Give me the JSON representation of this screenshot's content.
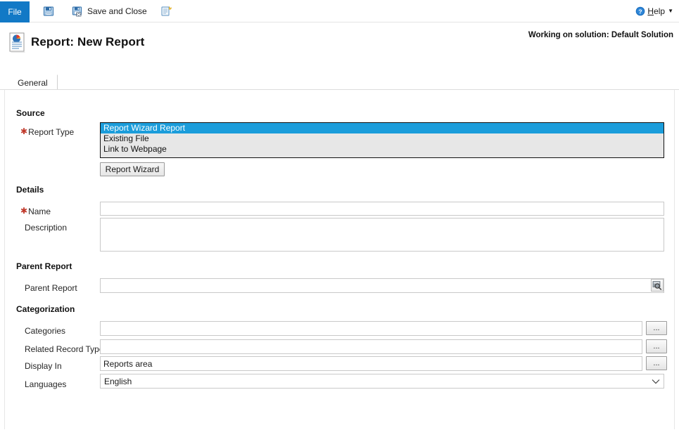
{
  "commandbar": {
    "file_tab": "File",
    "buttons": [
      {
        "name": "save-button",
        "icon": "save-icon",
        "label": ""
      },
      {
        "name": "save-and-close-button",
        "icon": "save-and-close-icon",
        "label": "Save and Close"
      },
      {
        "name": "new-button",
        "icon": "new-record-icon",
        "label": ""
      }
    ],
    "help": {
      "icon": "help-icon",
      "label_prefix": "",
      "label_accesskey": "H",
      "label_rest": "elp",
      "caret": "▼"
    }
  },
  "header": {
    "icon": "report-icon",
    "title": "Report: New Report",
    "solution_note": "Working on solution: Default Solution"
  },
  "tabs": [
    {
      "label": "General",
      "active": true
    }
  ],
  "form": {
    "sections": [
      {
        "key": "source",
        "title": "Source"
      },
      {
        "key": "details",
        "title": "Details"
      },
      {
        "key": "parent",
        "title": "Parent Report"
      },
      {
        "key": "categorization",
        "title": "Categorization"
      }
    ],
    "report_type": {
      "label": "Report Type",
      "required": true,
      "options": [
        {
          "label": "Report Wizard Report",
          "selected": true
        },
        {
          "label": "Existing File",
          "selected": false
        },
        {
          "label": "Link to Webpage",
          "selected": false
        }
      ]
    },
    "report_wizard_button": "Report Wizard",
    "name": {
      "label": "Name",
      "required": true,
      "value": "",
      "placeholder": ""
    },
    "description": {
      "label": "Description",
      "required": false,
      "value": "",
      "placeholder": ""
    },
    "parent_report": {
      "label": "Parent Report",
      "required": false,
      "value": "",
      "placeholder": "",
      "lookup_icon": "lookup-magnifier-icon"
    },
    "categories": {
      "label": "Categories",
      "value": "",
      "placeholder": "",
      "browse_label": "..."
    },
    "related_record_types": {
      "label": "Related Record Types",
      "value": "",
      "placeholder": "",
      "browse_label": "..."
    },
    "display_in": {
      "label": "Display In",
      "value": "Reports area",
      "placeholder": "",
      "browse_label": "..."
    },
    "languages": {
      "label": "Languages",
      "value": "English",
      "chevron": "chevron-down-icon"
    }
  },
  "colors": {
    "file_tab_blue": "#1279c6",
    "list_selection_blue": "#1b9ddb",
    "required_star_red": "#c0392b",
    "help_blue": "#1b6fc0",
    "field_border": "#c9c9c9"
  }
}
